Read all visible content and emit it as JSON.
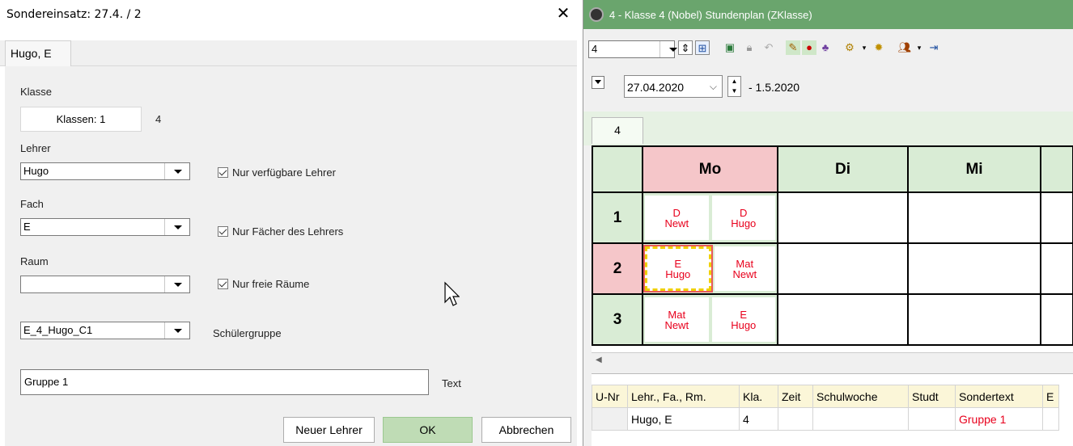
{
  "dialog": {
    "title": "Sondereinsatz: 27.4. / 2",
    "close_glyph": "✕",
    "tab_label": "Hugo, E",
    "klasse_label": "Klasse",
    "klassen_button": "Klassen: 1",
    "klassen_value": "4",
    "lehrer_label": "Lehrer",
    "lehrer_value": "Hugo",
    "lehrer_check_label": "Nur verfügbare Lehrer",
    "fach_label": "Fach",
    "fach_value": "E",
    "fach_check_label": "Nur Fächer des Lehrers",
    "raum_label": "Raum",
    "raum_value": "",
    "raum_check_label": "Nur freie Räume",
    "gruppe_value": "E_4_Hugo_C1",
    "gruppe_label": "Schülergruppe",
    "text_value": "Gruppe 1",
    "text_label": "Text",
    "btn_new_teacher": "Neuer Lehrer",
    "btn_ok": "OK",
    "btn_cancel": "Abbrechen"
  },
  "window": {
    "title": "4 - Klasse 4 (Nobel)  Stundenplan  (ZKlasse)",
    "class_select": "4",
    "date_value": "27.04.2020",
    "date_range": "- 1.5.2020",
    "class_tab": "4",
    "days": [
      "Mo",
      "Di",
      "Mi"
    ],
    "periods": [
      {
        "num": "1",
        "a_subj": "D",
        "a_teacher": "Newt",
        "b_subj": "D",
        "b_teacher": "Hugo"
      },
      {
        "num": "2",
        "a_subj": "E",
        "a_teacher": "Hugo",
        "b_subj": "Mat",
        "b_teacher": "Newt"
      },
      {
        "num": "3",
        "a_subj": "Mat",
        "a_teacher": "Newt",
        "b_subj": "E",
        "b_teacher": "Hugo"
      }
    ],
    "table_headers": [
      "U-Nr",
      "Lehr., Fa., Rm.",
      "Kla.",
      "Zeit",
      "Schulwoche",
      "Studt",
      "Sondertext",
      "E"
    ],
    "table_row": [
      "",
      "Hugo, E",
      "4",
      "",
      "",
      "",
      "Gruppe 1",
      ""
    ]
  },
  "colors": {
    "title_green": "#6aa56d",
    "highlight_pink": "#f5c6c9",
    "cell_green": "#d9ecd5",
    "lesson_red": "#e8001c",
    "ok_green": "#bfdcb5"
  }
}
